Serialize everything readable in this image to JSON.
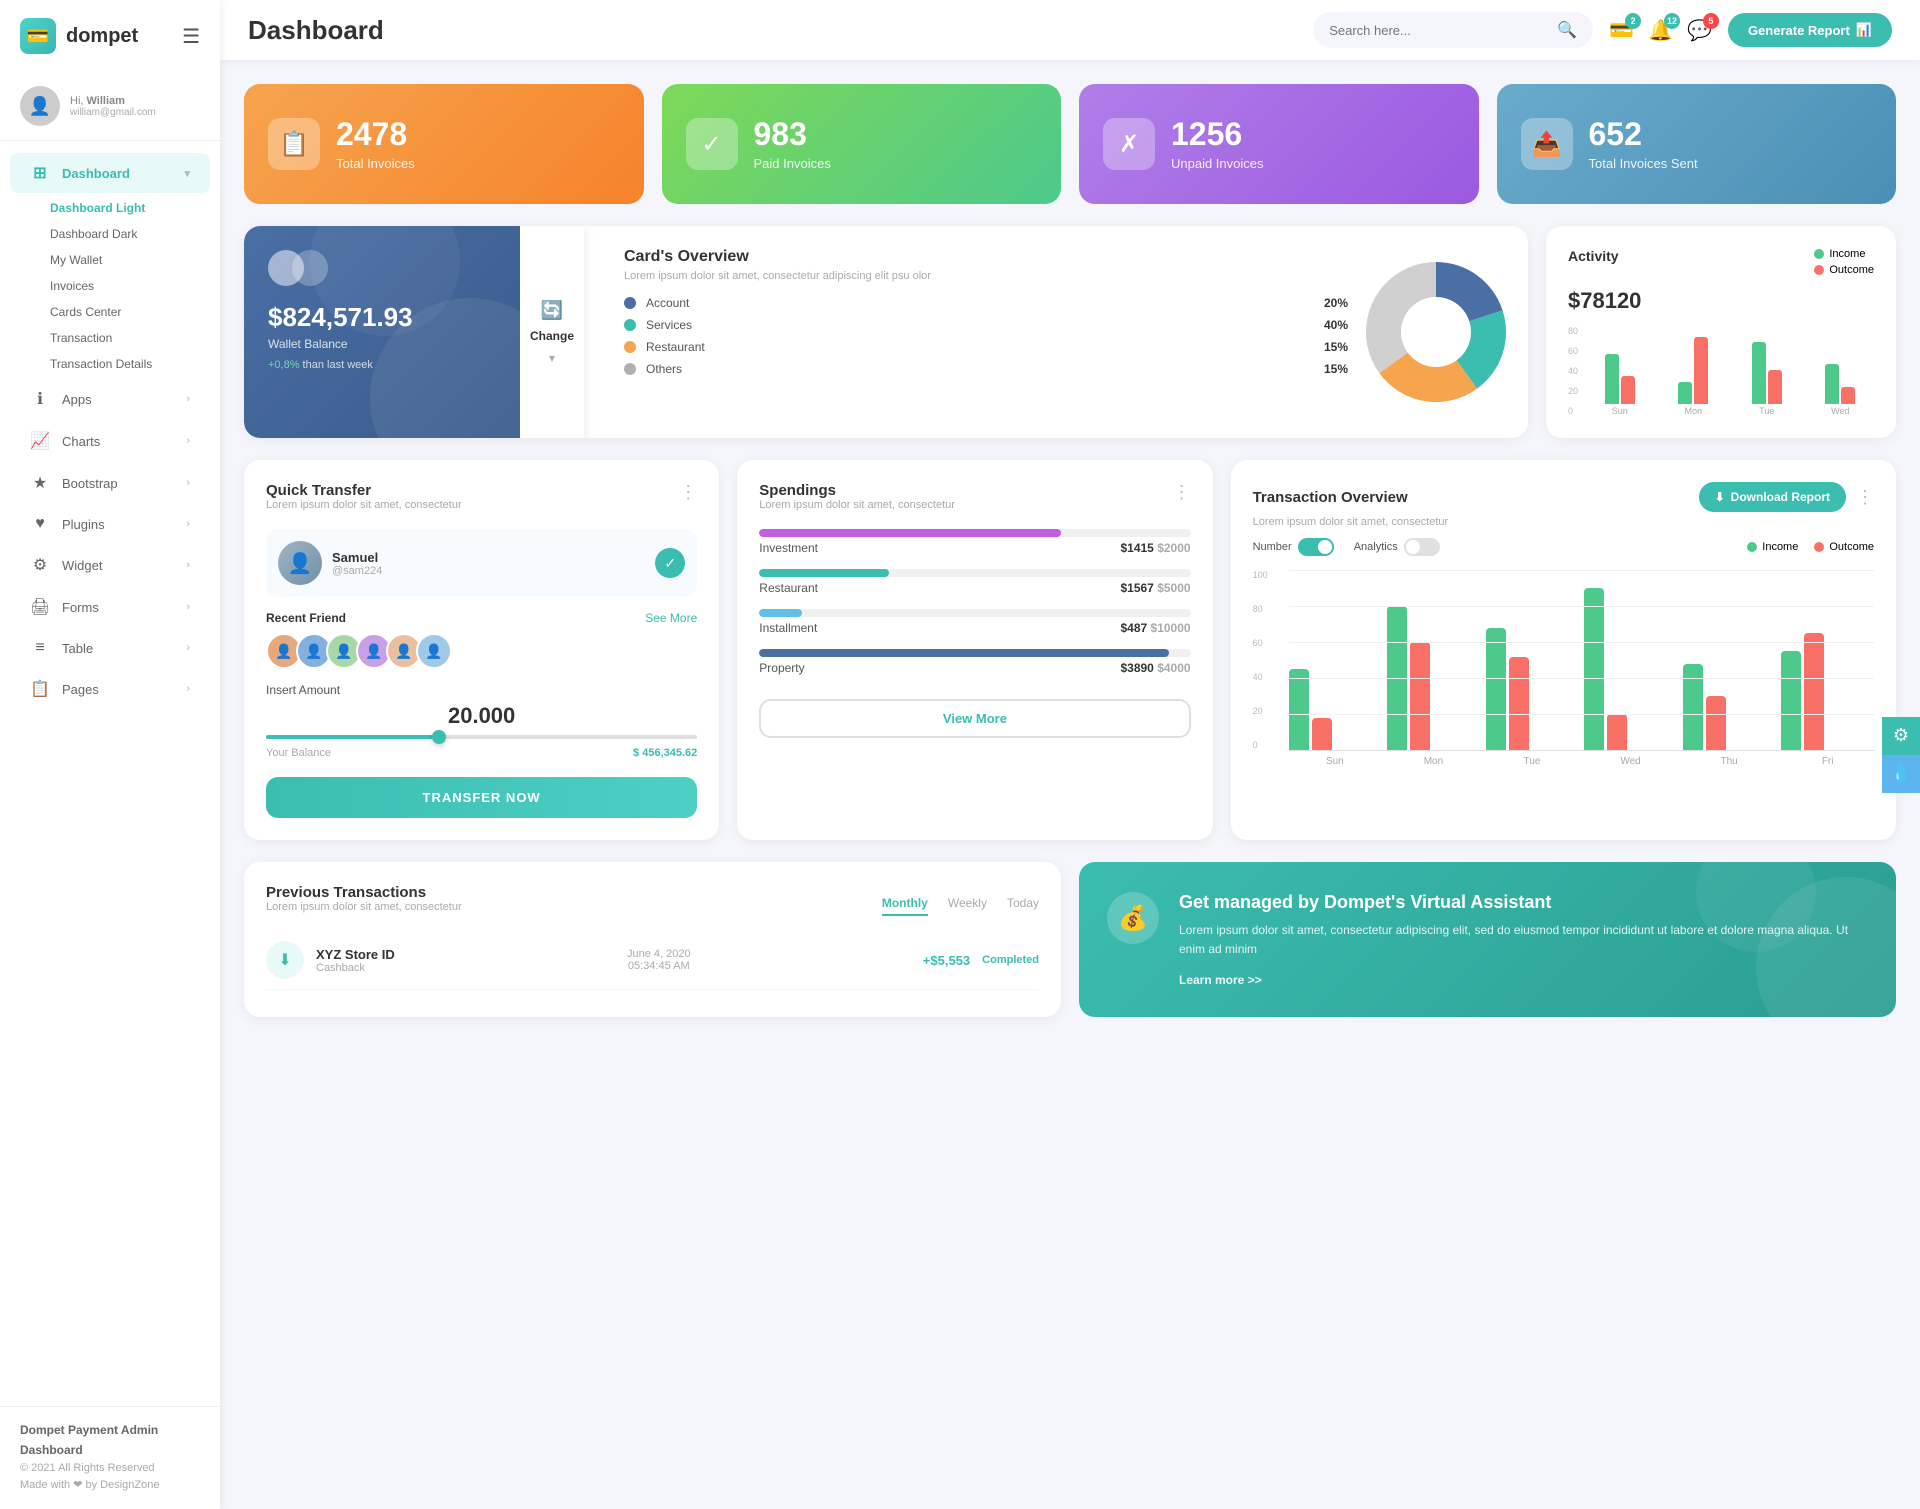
{
  "sidebar": {
    "logo": "dompet",
    "hamburger": "☰",
    "user": {
      "greeting": "Hi,",
      "name": "William",
      "email": "william@gmail.com"
    },
    "nav": [
      {
        "id": "dashboard",
        "icon": "⊞",
        "label": "Dashboard",
        "active": true,
        "arrow": "▾",
        "children": [
          {
            "label": "Dashboard Light",
            "active": true
          },
          {
            "label": "Dashboard Dark"
          },
          {
            "label": "My Wallet"
          },
          {
            "label": "Invoices"
          },
          {
            "label": "Cards Center"
          },
          {
            "label": "Transaction"
          },
          {
            "label": "Transaction Details"
          }
        ]
      },
      {
        "id": "apps",
        "icon": "ℹ",
        "label": "Apps",
        "arrow": "›"
      },
      {
        "id": "charts",
        "icon": "📈",
        "label": "Charts",
        "arrow": "›"
      },
      {
        "id": "bootstrap",
        "icon": "★",
        "label": "Bootstrap",
        "arrow": "›"
      },
      {
        "id": "plugins",
        "icon": "♥",
        "label": "Plugins",
        "arrow": "›"
      },
      {
        "id": "widget",
        "icon": "⚙",
        "label": "Widget",
        "arrow": "›"
      },
      {
        "id": "forms",
        "icon": "🖨",
        "label": "Forms",
        "arrow": "›"
      },
      {
        "id": "table",
        "icon": "≡",
        "label": "Table",
        "arrow": "›"
      },
      {
        "id": "pages",
        "icon": "📋",
        "label": "Pages",
        "arrow": "›"
      }
    ],
    "footer": {
      "brand": "Dompet Payment Admin Dashboard",
      "copyright": "© 2021 All Rights Reserved",
      "made": "Made with ❤ by DesignZone"
    }
  },
  "header": {
    "title": "Dashboard",
    "search_placeholder": "Search here...",
    "icons": {
      "wallet_badge": "2",
      "bell_badge": "12",
      "chat_badge": "5"
    },
    "generate_btn": "Generate Report"
  },
  "stat_cards": [
    {
      "id": "total-invoices",
      "color": "orange",
      "icon": "📋",
      "number": "2478",
      "label": "Total Invoices"
    },
    {
      "id": "paid-invoices",
      "color": "green",
      "icon": "✓",
      "number": "983",
      "label": "Paid Invoices"
    },
    {
      "id": "unpaid-invoices",
      "color": "purple",
      "icon": "✗",
      "number": "1256",
      "label": "Unpaid Invoices"
    },
    {
      "id": "total-sent",
      "color": "blue-gray",
      "icon": "📤",
      "number": "652",
      "label": "Total Invoices Sent"
    }
  ],
  "wallet": {
    "amount": "$824,571.93",
    "label": "Wallet Balance",
    "change": "+0.8% than last week"
  },
  "change_btn": "Change",
  "cards_overview": {
    "title": "Card's Overview",
    "desc": "Lorem ipsum dolor sit amet, consectetur adipiscing elit psu olor",
    "items": [
      {
        "label": "Account",
        "pct": "20%",
        "color": "#4a6fa5"
      },
      {
        "label": "Services",
        "pct": "40%",
        "color": "#3bbdb0"
      },
      {
        "label": "Restaurant",
        "pct": "15%",
        "color": "#f7a44f"
      },
      {
        "label": "Others",
        "pct": "15%",
        "color": "#b0b0b0"
      }
    ]
  },
  "activity": {
    "title": "Activity",
    "amount": "$78120",
    "legend": [
      {
        "label": "Income",
        "color": "#4dc98b"
      },
      {
        "label": "Outcome",
        "color": "#f97066"
      }
    ],
    "bars": [
      {
        "day": "Sun",
        "income": 45,
        "outcome": 25
      },
      {
        "day": "Mon",
        "income": 20,
        "outcome": 60
      },
      {
        "day": "Tue",
        "income": 55,
        "outcome": 30
      },
      {
        "day": "Wed",
        "income": 35,
        "outcome": 15
      }
    ],
    "y_labels": [
      "0",
      "20",
      "40",
      "60",
      "80"
    ]
  },
  "quick_transfer": {
    "title": "Quick Transfer",
    "desc": "Lorem ipsum dolor sit amet, consectetur",
    "user": {
      "name": "Samuel",
      "handle": "@sam224",
      "avatar_color": "#7090a8"
    },
    "recent_label": "Recent Friend",
    "see_more": "See More",
    "friends": [
      {
        "color": "#e8a87c"
      },
      {
        "color": "#82b1e0"
      },
      {
        "color": "#a8d8a8"
      },
      {
        "color": "#c8a0e8"
      },
      {
        "color": "#e8c0a0"
      },
      {
        "color": "#a0c8e8"
      }
    ],
    "insert_label": "Insert Amount",
    "insert_value": "20.000",
    "slider_pct": 40,
    "balance_label": "Your Balance",
    "balance_value": "$ 456,345.62",
    "transfer_btn": "TRANSFER NOW"
  },
  "spendings": {
    "title": "Spendings",
    "desc": "Lorem ipsum dolor sit amet, consectetur",
    "items": [
      {
        "label": "Investment",
        "amount": "$1415",
        "limit": "$2000",
        "fill_pct": 70,
        "color": "#c060e0"
      },
      {
        "label": "Restaurant",
        "amount": "$1567",
        "limit": "$5000",
        "fill_pct": 30,
        "color": "#3bbdb0"
      },
      {
        "label": "Installment",
        "amount": "$487",
        "limit": "$10000",
        "fill_pct": 10,
        "color": "#60c0e8"
      },
      {
        "label": "Property",
        "amount": "$3890",
        "limit": "$4000",
        "fill_pct": 95,
        "color": "#4a6fa5"
      }
    ],
    "view_more": "View More"
  },
  "tx_overview": {
    "title": "Transaction Overview",
    "desc": "Lorem ipsum dolor sit amet, consectetur",
    "toggle1_label": "Number",
    "toggle1_on": true,
    "toggle2_label": "Analytics",
    "toggle2_on": false,
    "legend": [
      {
        "label": "Income",
        "color": "#4dc98b"
      },
      {
        "label": "Outcome",
        "color": "#f97066"
      }
    ],
    "download_btn": "Download Report",
    "bars": [
      {
        "day": "Sun",
        "income": 45,
        "outcome": 18
      },
      {
        "day": "Mon",
        "income": 80,
        "outcome": 60
      },
      {
        "day": "Tue",
        "income": 68,
        "outcome": 52
      },
      {
        "day": "Wed",
        "income": 90,
        "outcome": 20
      },
      {
        "day": "Thu",
        "income": 48,
        "outcome": 30
      },
      {
        "day": "Fri",
        "income": 55,
        "outcome": 65
      }
    ],
    "y_labels": [
      "0",
      "20",
      "40",
      "60",
      "80",
      "100"
    ]
  },
  "prev_tx": {
    "title": "Previous Transactions",
    "desc": "Lorem ipsum dolor sit amet, consectetur",
    "tabs": [
      "Monthly",
      "Weekly",
      "Today"
    ],
    "active_tab": 0,
    "rows": [
      {
        "icon": "⬇",
        "name": "XYZ Store ID",
        "type": "Cashback",
        "date": "June 4, 2020",
        "time": "05:34:45 AM",
        "amount": "+$5,553",
        "status": "Completed",
        "icon_color": "#3bbdb0"
      }
    ]
  },
  "virtual_assistant": {
    "title": "Get managed by Dompet's Virtual Assistant",
    "desc": "Lorem ipsum dolor sit amet, consectetur adipiscing elit, sed do eiusmod tempor incididunt ut labore et dolore magna aliqua. Ut enim ad minim",
    "link": "Learn more >>"
  }
}
